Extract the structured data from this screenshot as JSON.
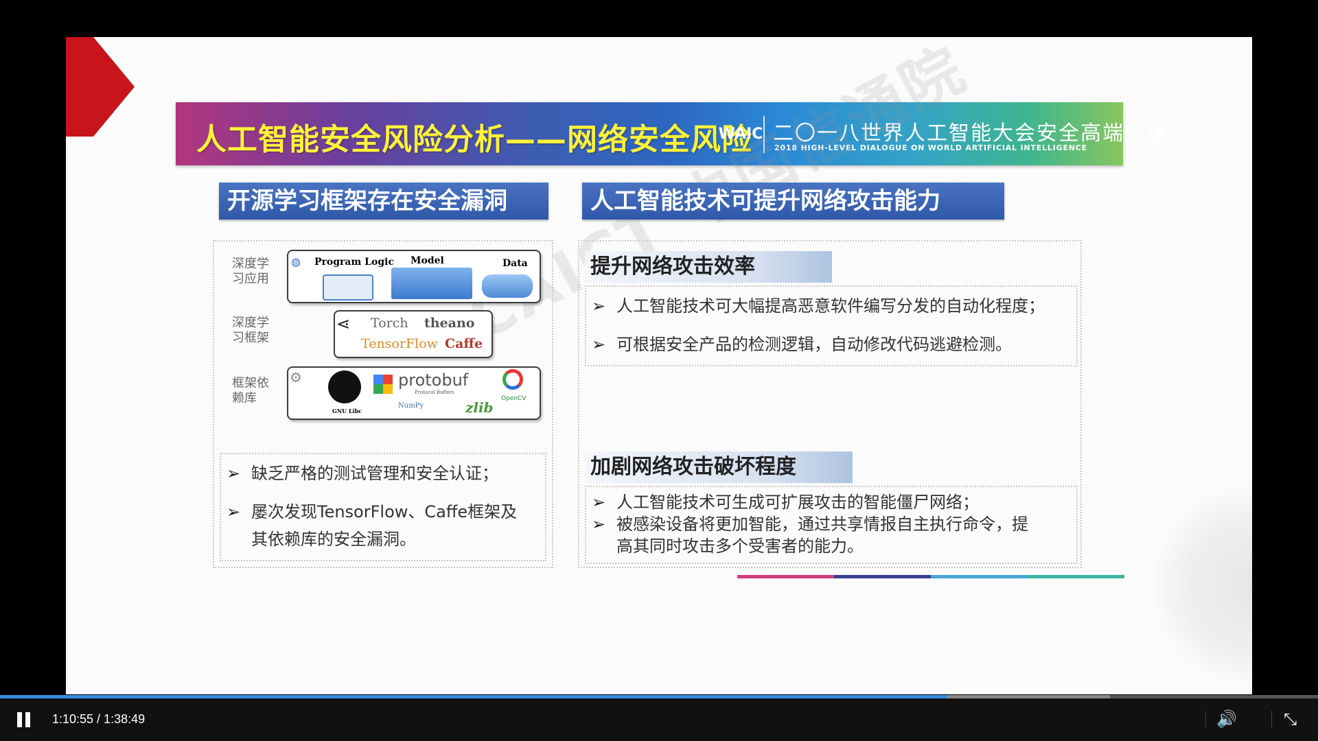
{
  "slide": {
    "title": "人工智能安全风险分析——网络安全风险",
    "logo_text": "WAIC",
    "conference_cn": "二〇一八世界人工智能大会安全高端对话",
    "conference_en": "2018 HIGH-LEVEL DIALOGUE ON WORLD ARTIFICIAL INTELLIGENCE",
    "watermark": "CAICT 中国信通院",
    "left": {
      "header": "开源学习框架存在安全漏洞",
      "stack_labels": [
        "深度学习应用",
        "深度学习框架",
        "框架依赖库"
      ],
      "app_panel": {
        "items": [
          "Program Logic",
          "Model",
          "Data"
        ]
      },
      "framework_panel": {
        "items": [
          "Torch",
          "theano",
          "TensorFlow",
          "Caffe"
        ]
      },
      "library_panel": {
        "items": [
          "GNU Libc",
          "protobuf",
          "Protocol Buffers",
          "NumPy",
          "zlib",
          "OpenCV"
        ]
      },
      "bullets": [
        "缺乏严格的测试管理和安全认证；",
        "屡次发现TensorFlow、Caffe框架及",
        "其依赖库的安全漏洞。"
      ]
    },
    "right": {
      "header": "人工智能技术可提升网络攻击能力",
      "section1": {
        "heading": "提升网络攻击效率",
        "bullets": [
          "人工智能技术可大幅提高恶意软件编写分发的自动化程度；",
          "可根据安全产品的检测逻辑，自动修改代码逃避检测。"
        ]
      },
      "section2": {
        "heading": "加剧网络攻击破坏程度",
        "bullets": [
          "人工智能技术可生成可扩展攻击的智能僵尸网络；",
          "被感染设备将更加智能，通过共享情报自主执行命令，提",
          "高其同时攻击多个受害者的能力。"
        ]
      }
    },
    "bullet_arrow": "➢"
  },
  "player": {
    "time": "1:10:55 / 1:38:49",
    "progress_fraction": 0.718,
    "buffer_fraction": 0.842,
    "icons": {
      "pause": "pause-icon",
      "volume": "volume-icon",
      "exit_fullscreen": "exit-fullscreen-icon"
    },
    "volume_glyph": "🔊",
    "exit_fullscreen_glyph": "⤡",
    "accent_color": "#2f8fe0"
  }
}
